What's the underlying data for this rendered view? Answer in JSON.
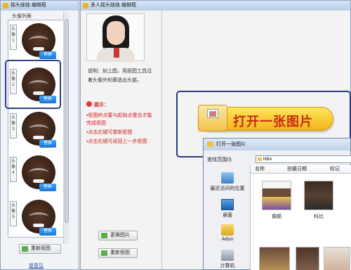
{
  "left_window": {
    "title": "摇头娃娃 编辑框",
    "list_title": "头像列表",
    "items": [
      {
        "tag": "头像1",
        "button": "替换"
      },
      {
        "tag": "头像2",
        "button": "替换"
      },
      {
        "tag": "头像3",
        "button": "替换"
      },
      {
        "tag": "头像4",
        "button": "替换"
      },
      {
        "tag": "头像5",
        "button": "替换"
      }
    ],
    "recrop_button": "重新抠图",
    "feedback_link": "提意见"
  },
  "middle_window": {
    "title": "多人摇头娃娃 编辑框",
    "description": "说明：如上图，用抠图工具沿着头像外轮廓选出头部。",
    "tips_title": "提示：",
    "tips": [
      "抠图终点要与起始点重合才能完成抠图",
      "点击右键可重新抠图",
      "点击右键可返回上一步抠图"
    ],
    "replace_image_button": "更换图片",
    "recrop_button": "重新抠图"
  },
  "open_image_button": "打开一张图片",
  "file_dialog": {
    "title": "打开一张图片",
    "look_in_label": "查找范围(I):",
    "look_in_value": "NBA",
    "places": [
      "最近访问的位置",
      "桌面",
      "Adun",
      "计算机"
    ],
    "columns": [
      "名称",
      "拍摄日期",
      "标记"
    ],
    "files": [
      "佩顿",
      "科比",
      "",
      "",
      ""
    ]
  },
  "colors": {
    "title_bar": "#c9d9ee",
    "tip_red": "#d41b1b",
    "big_button_yellow": "#f6c93a",
    "big_button_text": "#c62b10",
    "highlight_ring": "#2a3b80",
    "replace_blue": "#1b74d6"
  }
}
